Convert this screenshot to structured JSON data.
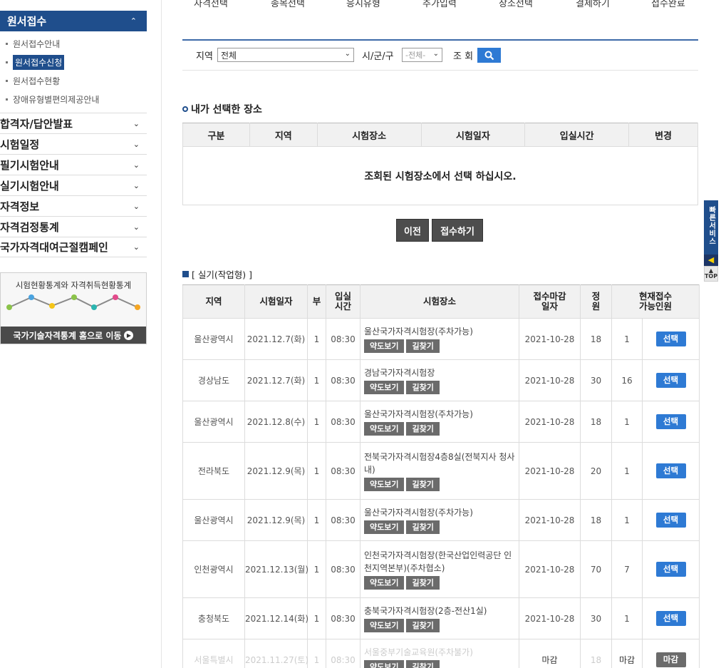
{
  "sidebar": {
    "title": "원서접수",
    "sub_items": [
      {
        "label": "원서접수안내",
        "active": false
      },
      {
        "label": "원서접수신청",
        "active": true
      },
      {
        "label": "원서접수현황",
        "active": false
      },
      {
        "label": "장애유형별편의제공안내",
        "active": false
      }
    ],
    "menu": [
      "합격자/답안발표",
      "시험일정",
      "필기시험안내",
      "실기시험안내",
      "자격정보",
      "자격검정통계",
      "국가자격대여근절캠페인"
    ],
    "stat_banner": {
      "title": "시험현황통계와 자격취득현황통계",
      "link": "국가기술자격통계 홈으로 이동"
    }
  },
  "steps": [
    "자격선택",
    "종목선택",
    "응시유형",
    "추가입력",
    "장소선택",
    "결제하기",
    "접수완료"
  ],
  "search": {
    "region_label": "지역",
    "region_value": "전체",
    "city_label": "시/군/구",
    "city_value": "-전체-",
    "search_label": "조 회"
  },
  "my_place": {
    "title": "내가 선택한 장소",
    "headers": [
      "구분",
      "지역",
      "시험장소",
      "시험일자",
      "입실시간",
      "변경"
    ],
    "empty_message": "조회된 시험장소에서 선택 하십시오."
  },
  "buttons": {
    "prev": "이전",
    "submit": "접수하기"
  },
  "practical": {
    "title": "[ 실기(작업형) ]",
    "headers": {
      "region": "지역",
      "date": "시험일자",
      "part": "부",
      "entry_line1": "입실",
      "entry_line2": "시간",
      "place": "시험장소",
      "deadline_line1": "접수마감",
      "deadline_line2": "일자",
      "quota_line1": "정",
      "quota_line2": "원",
      "avail_line1": "현재접수",
      "avail_line2": "가능인원"
    },
    "map_label": "약도보기",
    "route_label": "길찾기",
    "rows": [
      {
        "region": "울산광역시",
        "date": "2021.12.7(화)",
        "part": "1",
        "time": "08:30",
        "place": "울산국가자격시험장(주차가능)",
        "deadline": "2021-10-28",
        "quota": "18",
        "available": "1",
        "action": "선택"
      },
      {
        "region": "경상남도",
        "date": "2021.12.7(화)",
        "part": "1",
        "time": "08:30",
        "place": "경남국가자격시험장",
        "deadline": "2021-10-28",
        "quota": "30",
        "available": "16",
        "action": "선택"
      },
      {
        "region": "울산광역시",
        "date": "2021.12.8(수)",
        "part": "1",
        "time": "08:30",
        "place": "울산국가자격시험장(주차가능)",
        "deadline": "2021-10-28",
        "quota": "18",
        "available": "1",
        "action": "선택"
      },
      {
        "region": "전라북도",
        "date": "2021.12.9(목)",
        "part": "1",
        "time": "08:30",
        "place": "전북국가자격시험장4층8실(전북지사 청사 내)",
        "deadline": "2021-10-28",
        "quota": "20",
        "available": "1",
        "action": "선택"
      },
      {
        "region": "울산광역시",
        "date": "2021.12.9(목)",
        "part": "1",
        "time": "08:30",
        "place": "울산국가자격시험장(주차가능)",
        "deadline": "2021-10-28",
        "quota": "18",
        "available": "1",
        "action": "선택"
      },
      {
        "region": "인천광역시",
        "date": "2021.12.13(월)",
        "part": "1",
        "time": "08:30",
        "place": "인천국가자격시험장(한국산업인력공단 인천지역본부)(주차협소)",
        "deadline": "2021-10-28",
        "quota": "70",
        "available": "7",
        "action": "선택"
      },
      {
        "region": "충청북도",
        "date": "2021.12.14(화)",
        "part": "1",
        "time": "08:30",
        "place": "충북국가자격시험장(2층-전산1실)",
        "deadline": "2021-10-28",
        "quota": "30",
        "available": "1",
        "action": "선택"
      },
      {
        "region": "서울특별시",
        "date": "2021.11.27(토)",
        "part": "1",
        "time": "08:30",
        "place": "서울중부기술교육원(주차불가)",
        "deadline": "마감",
        "quota": "18",
        "available": "마감",
        "action": "마감"
      }
    ]
  },
  "quick_service": {
    "label": "빠른서비스",
    "top": "TOP"
  },
  "colors": {
    "primary": "#1f4e8c",
    "button_blue": "#2e7ad4",
    "button_gray": "#6b6b6b"
  }
}
